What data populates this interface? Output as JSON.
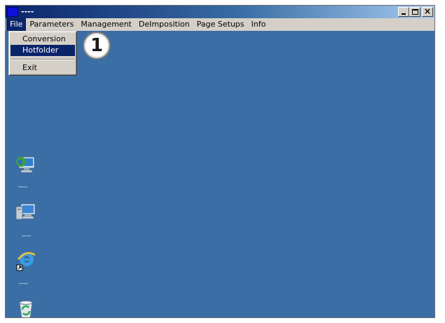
{
  "window": {
    "title": "----",
    "buttons": {
      "minimize": "_",
      "maximize": "□",
      "close": "×"
    }
  },
  "menubar": {
    "items": [
      "File",
      "Parameters",
      "Management",
      "DeImposition",
      "Page Setups",
      "Info"
    ],
    "active": "File"
  },
  "file_menu": {
    "items": [
      "Conversion",
      "Hotfolder",
      "Exit"
    ],
    "selected": "Hotfolder"
  },
  "callout": {
    "number": "1"
  },
  "desktop_icons": [
    {
      "icon": "network-globe-icon",
      "label": "----"
    },
    {
      "icon": "computer-icon",
      "label": "----"
    },
    {
      "icon": "internet-explorer-icon",
      "label": "----"
    },
    {
      "icon": "recycle-bin-icon",
      "label": ""
    }
  ],
  "colors": {
    "desktop": "#3a6ea5",
    "menubar": "#d4d0c8",
    "highlight": "#0a246a",
    "titlebar_start": "#0a246a",
    "titlebar_end": "#a6caf0"
  }
}
